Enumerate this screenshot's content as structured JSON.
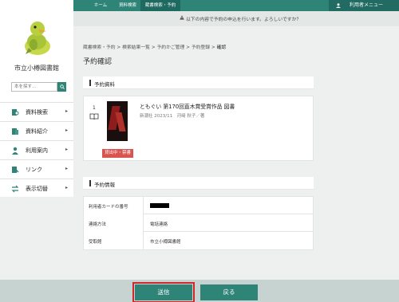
{
  "topnav": {
    "tabs": [
      {
        "label": "ホーム",
        "active": false
      },
      {
        "label": "資料検索",
        "active": false
      },
      {
        "label": "蔵書検索・予約",
        "active": true
      }
    ],
    "user_menu_label": "利用者メニュー"
  },
  "sidebar": {
    "library_name": "市立小樽図書館",
    "search_placeholder": "本を探す…",
    "items": [
      {
        "label": "資料検索",
        "icon": "book-search-icon"
      },
      {
        "label": "資料紹介",
        "icon": "book-intro-icon"
      },
      {
        "label": "利用案内",
        "icon": "person-icon"
      },
      {
        "label": "リンク",
        "icon": "link-icon"
      },
      {
        "label": "表示切替",
        "icon": "switch-arrows-icon"
      }
    ]
  },
  "notice": {
    "message": "以下の内容で予約の申込を行います。よろしいですか？"
  },
  "breadcrumb": {
    "items": [
      "蔵書検索・予約",
      "検索結果一覧",
      "予約かご管理",
      "予約登録"
    ],
    "current": "確認"
  },
  "page_title": "予約確認",
  "reservation_material": {
    "section_label": "予約資料",
    "number": "1",
    "title": "ともぐい 第170回直木賞受賞作品 図書",
    "meta": "新潮社 2023/11　河﨑 秋子／著",
    "status_badge": "貸出中・禁書"
  },
  "reservation_info": {
    "section_label": "予約情報",
    "rows": [
      {
        "label": "利用者カードの番号",
        "value": ""
      },
      {
        "label": "連絡方法",
        "value": "電話連絡"
      },
      {
        "label": "受取館",
        "value": "市立小樽図書館"
      }
    ]
  },
  "footer": {
    "send_label": "送信",
    "back_label": "戻る"
  },
  "colors": {
    "accent": "#2f8478",
    "badge": "#d9534f",
    "highlight": "#d2262b"
  }
}
